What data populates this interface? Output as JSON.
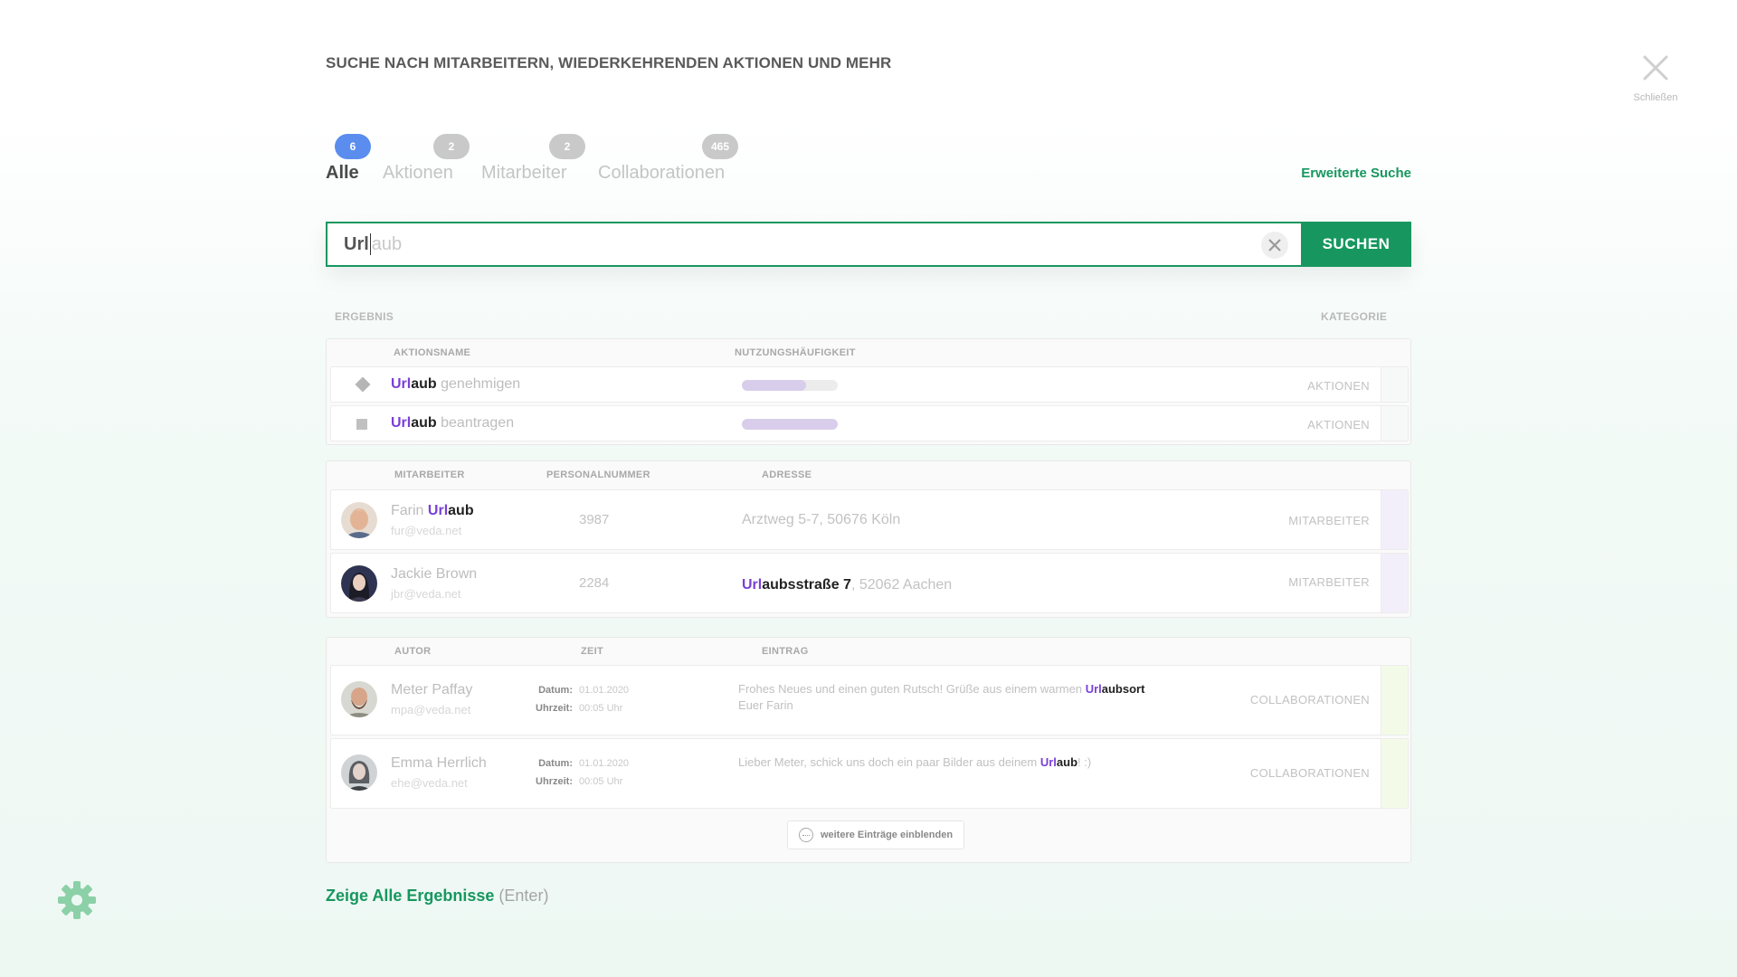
{
  "header": {
    "title": "SUCHE NACH MITARBEITERN, WIEDERKEHRENDEN AKTIONEN UND MEHR",
    "close_label": "Schließen"
  },
  "tabs": [
    {
      "label": "Alle",
      "count": "6",
      "active": true
    },
    {
      "label": "Aktionen",
      "count": "2",
      "active": false
    },
    {
      "label": "Mitarbeiter",
      "count": "2",
      "active": false
    },
    {
      "label": "Collaborationen",
      "count": "465",
      "active": false
    }
  ],
  "advanced_search_label": "Erweiterte Suche",
  "search": {
    "typed": "Url",
    "suggestion": "aub",
    "button_label": "SUCHEN"
  },
  "results_header": {
    "result": "ERGEBNIS",
    "category": "KATEGORIE"
  },
  "actions_group": {
    "columns": [
      "AKTIONSNAME",
      "NUTZUNGSHÄUFIGKEIT"
    ],
    "rows": [
      {
        "match": "Url",
        "rest_bold": "aub",
        "rest": " genehmigen",
        "usage": 0.67,
        "icon": "diamond-icon",
        "category": "AKTIONEN"
      },
      {
        "match": "Url",
        "rest_bold": "aub",
        "rest": " beantragen",
        "usage": 1.0,
        "icon": "square-icon",
        "category": "AKTIONEN"
      }
    ]
  },
  "employees_group": {
    "columns": [
      "MITARBEITER",
      "PERSONALNUMMER",
      "ADRESSE"
    ],
    "rows": [
      {
        "first_name": "Farin ",
        "name_match": "Url",
        "name_rest": "aub",
        "email": "fur@veda.net",
        "number": "3987",
        "addr_match": "",
        "addr_bold": "",
        "addr_rest": "Arztweg 5-7, 50676 Köln",
        "category": "MITARBEITER"
      },
      {
        "first_name": "Jackie  Brown",
        "name_match": "",
        "name_rest": "",
        "email": "jbr@veda.net",
        "number": "2284",
        "addr_match": "Url",
        "addr_bold": "aubsstraße 7",
        "addr_rest": ", 52062 Aachen",
        "category": "MITARBEITER"
      }
    ]
  },
  "collab_group": {
    "columns": [
      "AUTOR",
      "ZEIT",
      "EINTRAG"
    ],
    "date_label": "Datum:",
    "time_label": "Uhrzeit:",
    "rows": [
      {
        "name": "Meter Paffay",
        "email": "mpa@veda.net",
        "date": "01.01.2020",
        "time": "00:05 Uhr",
        "entry_pre": "Frohes Neues und einen guten Rutsch! Grüße aus einem warmen ",
        "entry_match": "Url",
        "entry_bold": "aubsort",
        "entry_post": "",
        "entry_line2": "Euer Farin",
        "category": "COLLABORATIONEN"
      },
      {
        "name": "Emma Herrlich",
        "email": "ehe@veda.net",
        "date": "01.01.2020",
        "time": "00:05 Uhr",
        "entry_pre": "Lieber Meter, schick uns doch ein paar Bilder aus deinem ",
        "entry_match": "Url",
        "entry_bold": "aub",
        "entry_post": "! :)",
        "entry_line2": "",
        "category": "COLLABORATIONEN"
      }
    ],
    "more_label": "weitere Einträge einblenden"
  },
  "footer": {
    "show_all": "Zeige Alle Ergebnisse",
    "show_all_hint": "(Enter)"
  },
  "colors": {
    "accent": "#17975f",
    "badge_active": "#5b8def",
    "highlight": "#7a3fd6",
    "employee_stripe": "#f3effa",
    "collab_stripe": "#f3fbe8"
  }
}
